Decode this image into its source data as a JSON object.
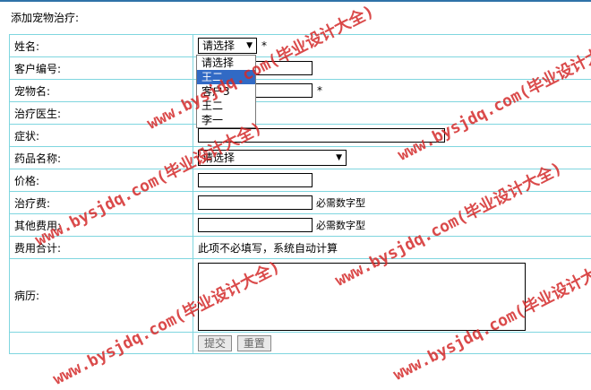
{
  "page": {
    "title": "添加宠物治疗:"
  },
  "form": {
    "name_label": "姓名:",
    "name_select": "请选择",
    "customer_id_label": "客户编号:",
    "pet_name_label": "宠物名:",
    "doctor_label": "治疗医生:",
    "symptom_label": "症状:",
    "drug_label": "药品名称:",
    "drug_select": "请选择",
    "price_label": "价格:",
    "treatment_fee_label": "治疗费:",
    "other_fee_label": "其他费用:",
    "total_label": "费用合计:",
    "total_note": "此项不必填写，系统自动计算",
    "history_label": "病历:",
    "required_mark": "*",
    "numeric_hint": "必需数字型",
    "submit": "提交",
    "reset": "重置"
  },
  "dropdown": {
    "options": [
      "请选择",
      "王二",
      "客户3",
      "王二",
      "李一"
    ],
    "highlighted_index": 1
  },
  "watermark": {
    "text": "www.bysjdq.com(毕业设计大全)",
    "color": "#d42b2b"
  }
}
